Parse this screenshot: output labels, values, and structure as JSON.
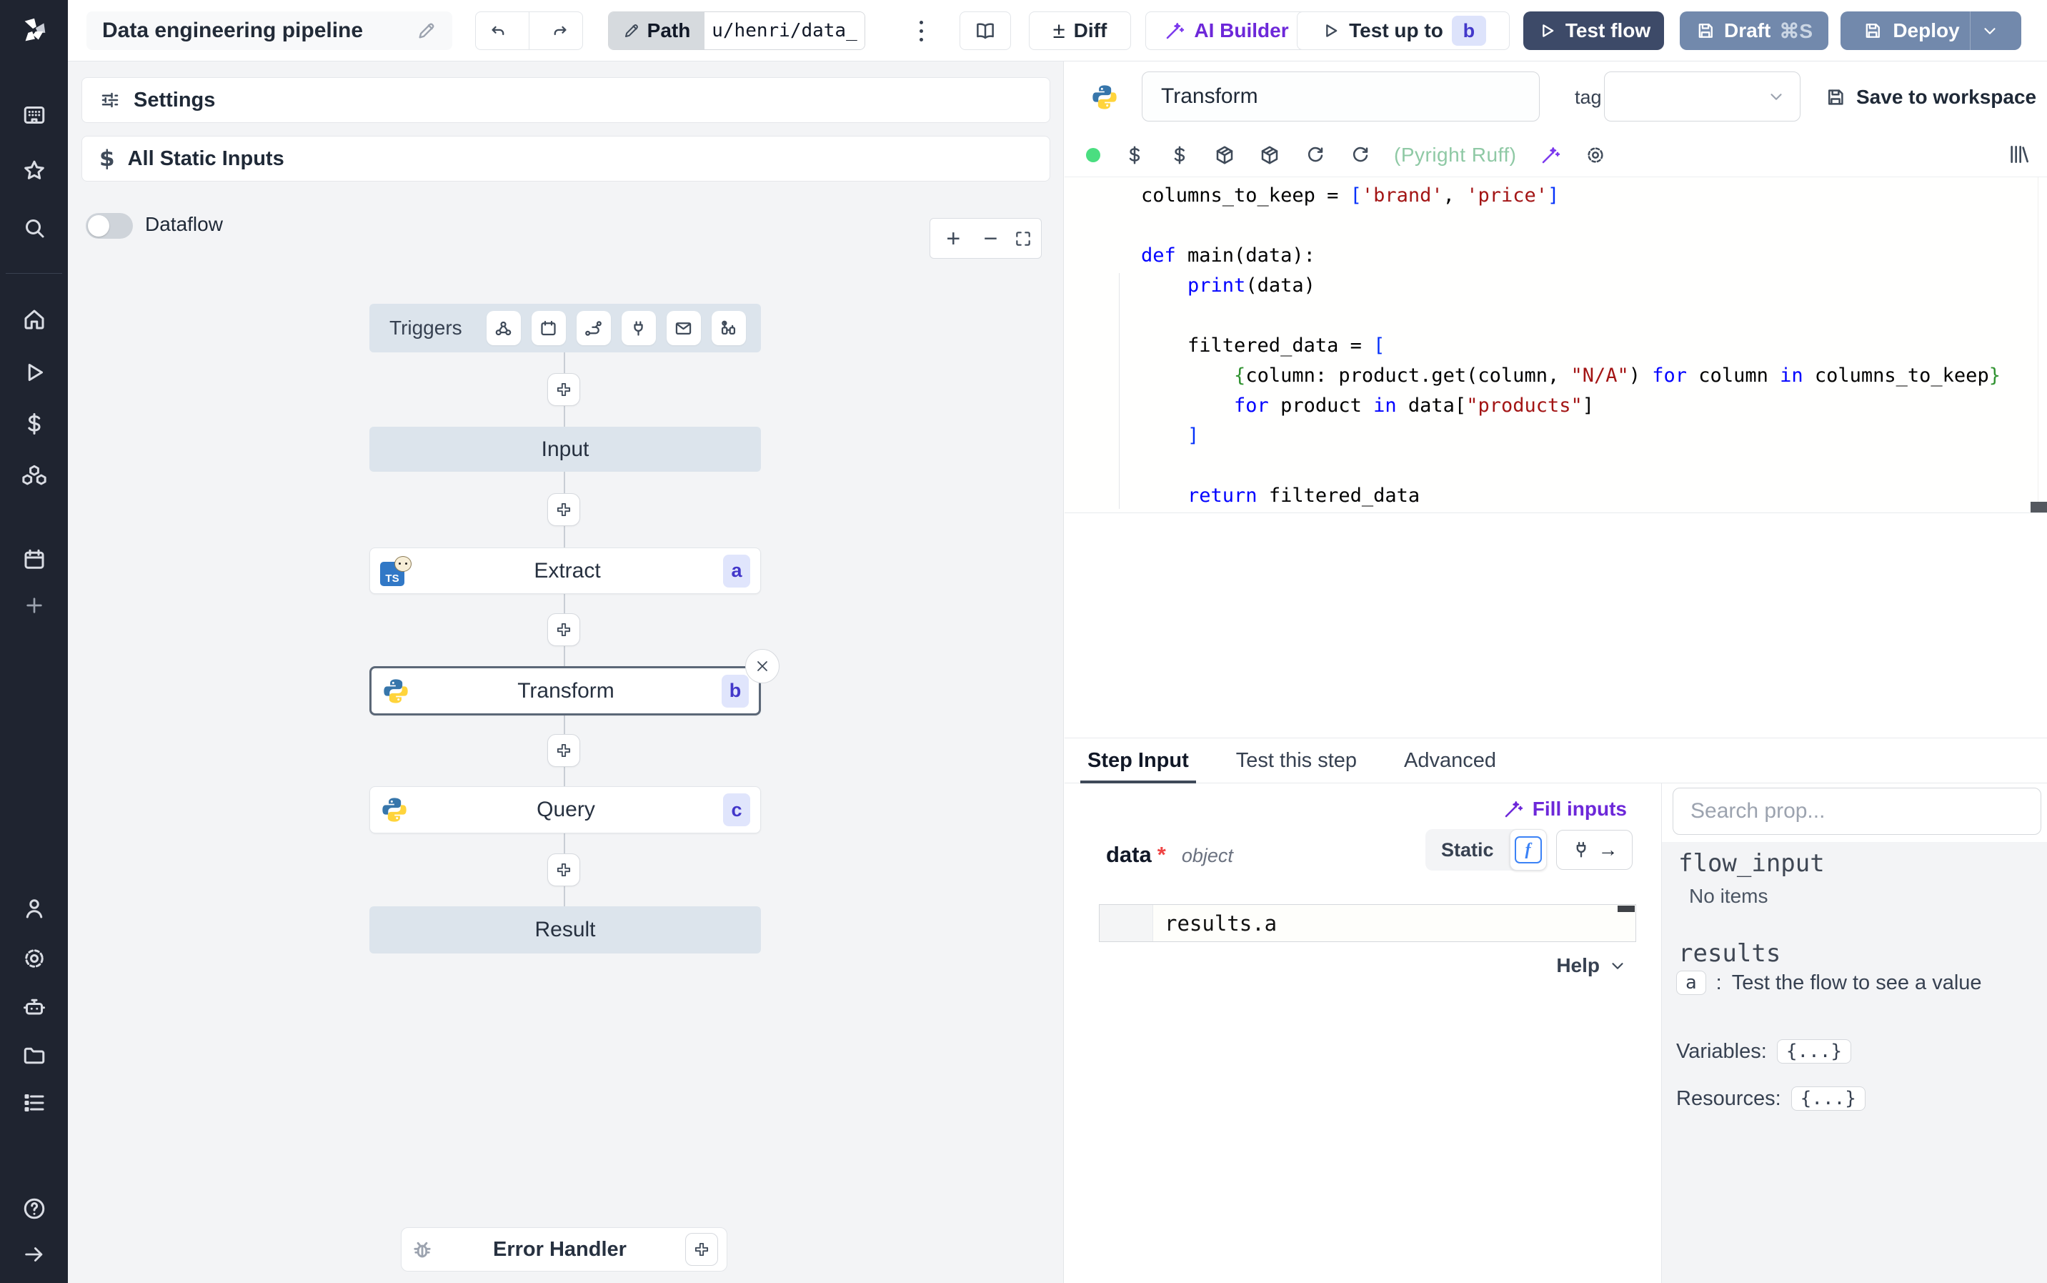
{
  "topbar": {
    "title": "Data engineering pipeline",
    "path_label": "Path",
    "path_value": "u/henri/data_",
    "diff_icon": "±",
    "diff_label": "Diff",
    "ai_builder_label": "AI Builder",
    "test_up_to_label": "Test up to",
    "test_up_to_badge": "b",
    "test_flow_label": "Test flow",
    "draft_label": "Draft",
    "draft_shortcut": "⌘S",
    "deploy_label": "Deploy"
  },
  "flow": {
    "settings_label": "Settings",
    "static_inputs_label": "All Static Inputs",
    "static_icon": "$",
    "dataflow_label": "Dataflow",
    "zoom_in": "+",
    "zoom_out": "−",
    "triggers_label": "Triggers",
    "nodes": {
      "input": "Input",
      "extract": {
        "label": "Extract",
        "badge": "a"
      },
      "transform": {
        "label": "Transform",
        "badge": "b"
      },
      "query": {
        "label": "Query",
        "badge": "c"
      },
      "result": "Result",
      "error_handler": "Error Handler"
    },
    "close_icon": "×"
  },
  "editor": {
    "step_name": "Transform",
    "tag_label": "tag",
    "save_label": "Save to workspace",
    "lint_status": "(Pyright Ruff)",
    "code": [
      [
        {
          "t": "columns_to_keep = "
        },
        {
          "t": "[",
          "c": "b1"
        },
        {
          "t": "'brand'",
          "c": "st"
        },
        {
          "t": ", "
        },
        {
          "t": "'price'",
          "c": "st"
        },
        {
          "t": "]",
          "c": "b1"
        }
      ],
      [],
      [
        {
          "t": "def",
          "c": "kw"
        },
        {
          "t": " main(data):"
        }
      ],
      [
        {
          "t": "    "
        },
        {
          "t": "print",
          "c": "kw"
        },
        {
          "t": "(data)"
        }
      ],
      [],
      [
        {
          "t": "    filtered_data = "
        },
        {
          "t": "[",
          "c": "b1"
        }
      ],
      [
        {
          "t": "        "
        },
        {
          "t": "{",
          "c": "b2"
        },
        {
          "t": "column: product.get(column, "
        },
        {
          "t": "\"N/A\"",
          "c": "st"
        },
        {
          "t": ") "
        },
        {
          "t": "for",
          "c": "kw"
        },
        {
          "t": " column "
        },
        {
          "t": "in",
          "c": "kw"
        },
        {
          "t": " columns_to_keep"
        },
        {
          "t": "}",
          "c": "b2"
        }
      ],
      [
        {
          "t": "        "
        },
        {
          "t": "for",
          "c": "kw"
        },
        {
          "t": " product "
        },
        {
          "t": "in",
          "c": "kw"
        },
        {
          "t": " data["
        },
        {
          "t": "\"products\"",
          "c": "st"
        },
        {
          "t": "]"
        }
      ],
      [
        {
          "t": "    "
        },
        {
          "t": "]",
          "c": "b1"
        }
      ],
      [],
      [
        {
          "t": "    "
        },
        {
          "t": "return",
          "c": "kw"
        },
        {
          "t": " filtered_data"
        }
      ]
    ]
  },
  "tabs": {
    "step_input": "Step Input",
    "test_step": "Test this step",
    "advanced": "Advanced",
    "fill_inputs": "Fill inputs"
  },
  "step_input": {
    "field_name": "data",
    "required_mark": "*",
    "field_type": "object",
    "static_label": "Static",
    "connect_arrow": "→",
    "expression": "results.a",
    "help_label": "Help"
  },
  "props": {
    "search_placeholder": "Search prop...",
    "flow_input_label": "flow_input",
    "no_items": "No items",
    "results_label": "results",
    "result_key": "a",
    "result_sep": ":",
    "result_desc": "Test the flow to see a value",
    "variables_label": "Variables:",
    "variables_value": "{...}",
    "resources_label": "Resources:",
    "resources_value": "{...}"
  },
  "colors": {
    "accent_purple": "#6d28d9",
    "primary_dark": "#3d4a68",
    "primary_slate": "#7289ac",
    "badge_bg": "#dde3fb",
    "badge_text": "#4338ca",
    "lint_green": "#8fc9a5",
    "sidebar_bg": "#1f2430"
  }
}
